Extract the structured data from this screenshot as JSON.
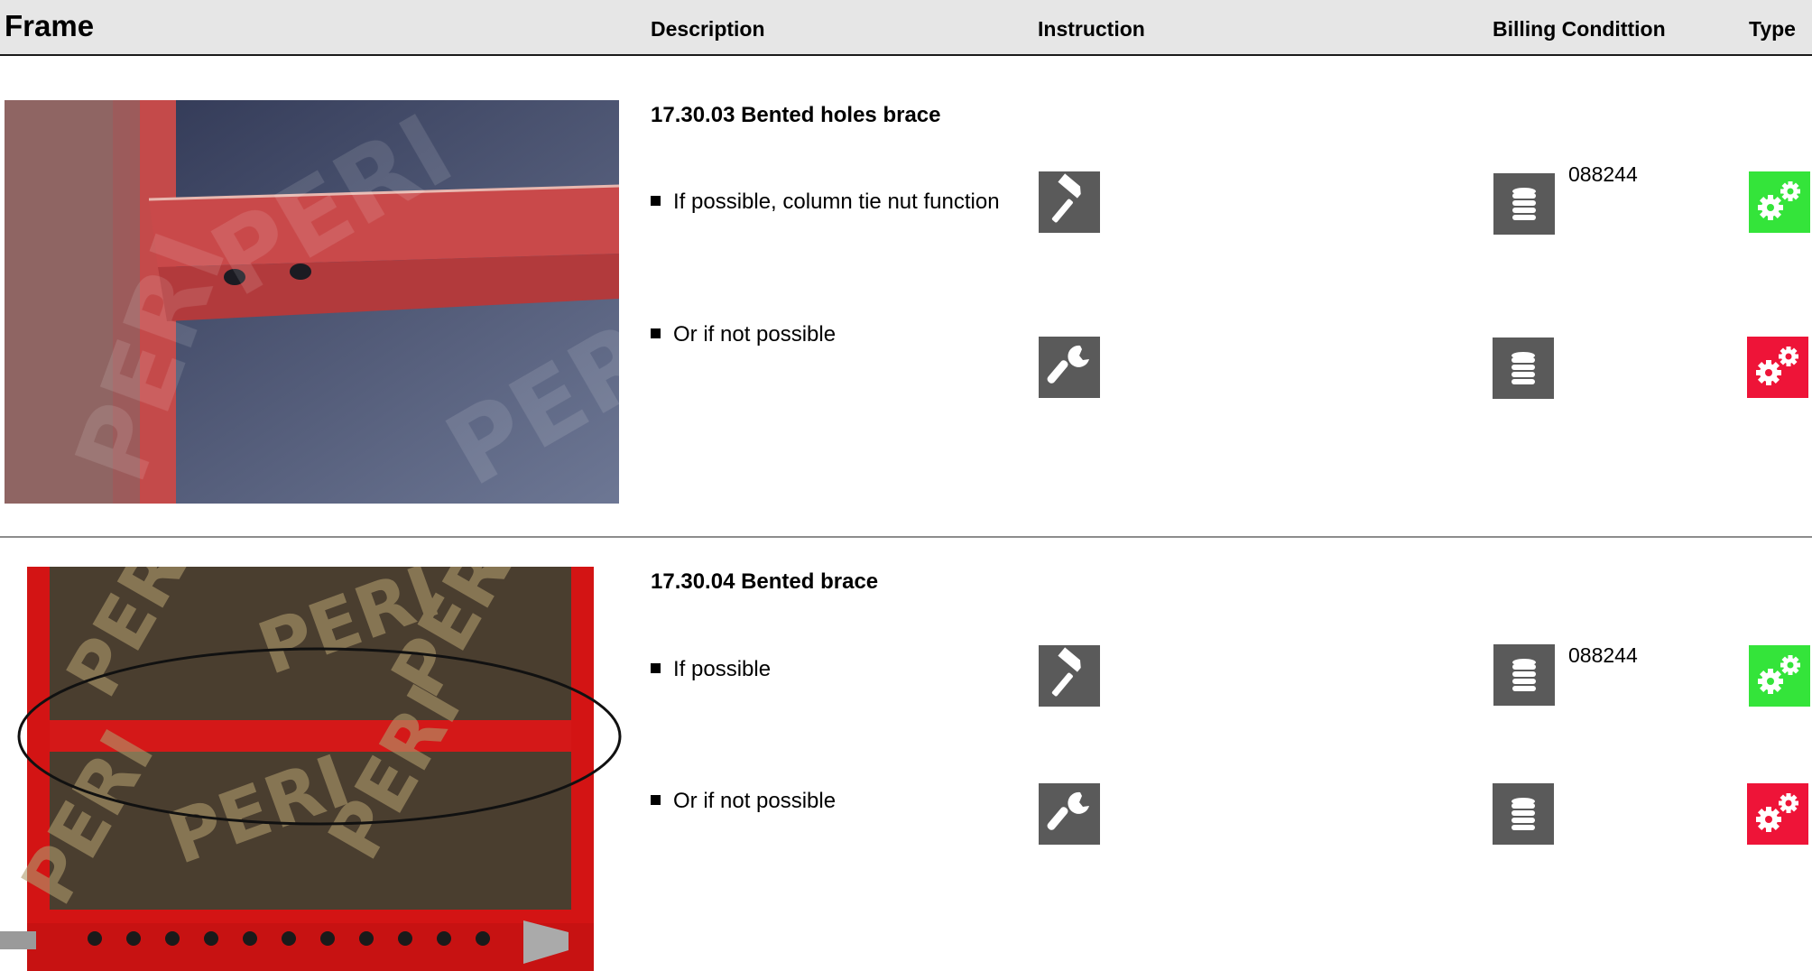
{
  "header": {
    "frame": "Frame",
    "description": "Description",
    "instruction": "Instruction",
    "billing": "Billing Condittion",
    "type": "Type"
  },
  "entries": [
    {
      "title": "17.30.03 Bented holes brace",
      "rows": [
        {
          "text": "If possible, column tie nut function",
          "instruction_icon": "hammer-icon",
          "billing_icon": "coin-stack-icon",
          "billing_code": "088244",
          "type_icon": "gears-icon",
          "type_color": "#34e43a"
        },
        {
          "text": "Or if not possible",
          "instruction_icon": "wrench-icon",
          "billing_icon": "coin-stack-icon",
          "billing_code": "",
          "type_icon": "gears-icon",
          "type_color": "#ee1438"
        }
      ]
    },
    {
      "title": "17.30.04 Bented brace",
      "rows": [
        {
          "text": "If possible",
          "instruction_icon": "hammer-icon",
          "billing_icon": "coin-stack-icon",
          "billing_code": "088244",
          "type_icon": "gears-icon",
          "type_color": "#34e43a"
        },
        {
          "text": "Or if not possible",
          "instruction_icon": "wrench-icon",
          "billing_icon": "coin-stack-icon",
          "billing_code": "",
          "type_icon": "gears-icon",
          "type_color": "#ee1438"
        }
      ]
    }
  ],
  "photos": [
    {
      "subject": "red-frame-brace-closeup",
      "watermark": "PERI"
    },
    {
      "subject": "red-frame-with-circled-brace",
      "watermark": "PERI"
    }
  ]
}
